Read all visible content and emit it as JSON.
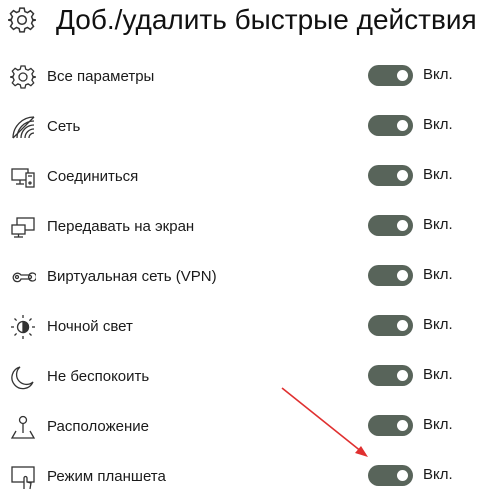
{
  "header": {
    "icon": "gear-icon",
    "title": "Доб./удалить быстрые действия"
  },
  "items": [
    {
      "icon": "gear-icon",
      "label": "Все параметры",
      "state": "Вкл.",
      "on": true
    },
    {
      "icon": "network-wifi-icon",
      "label": "Сеть",
      "state": "Вкл.",
      "on": true
    },
    {
      "icon": "connect-icon",
      "label": "Соединиться",
      "state": "Вкл.",
      "on": true
    },
    {
      "icon": "project-icon",
      "label": "Передавать на экран",
      "state": "Вкл.",
      "on": true
    },
    {
      "icon": "vpn-icon",
      "label": "Виртуальная сеть (VPN)",
      "state": "Вкл.",
      "on": true
    },
    {
      "icon": "night-light-icon",
      "label": "Ночной свет",
      "state": "Вкл.",
      "on": true
    },
    {
      "icon": "moon-icon",
      "label": "Не беспокоить",
      "state": "Вкл.",
      "on": true
    },
    {
      "icon": "location-icon",
      "label": "Расположение",
      "state": "Вкл.",
      "on": true
    },
    {
      "icon": "tablet-mode-icon",
      "label": "Режим планшета",
      "state": "Вкл.",
      "on": true
    }
  ],
  "colors": {
    "toggle_on": "#58645a",
    "annotation_arrow": "#e03030"
  }
}
